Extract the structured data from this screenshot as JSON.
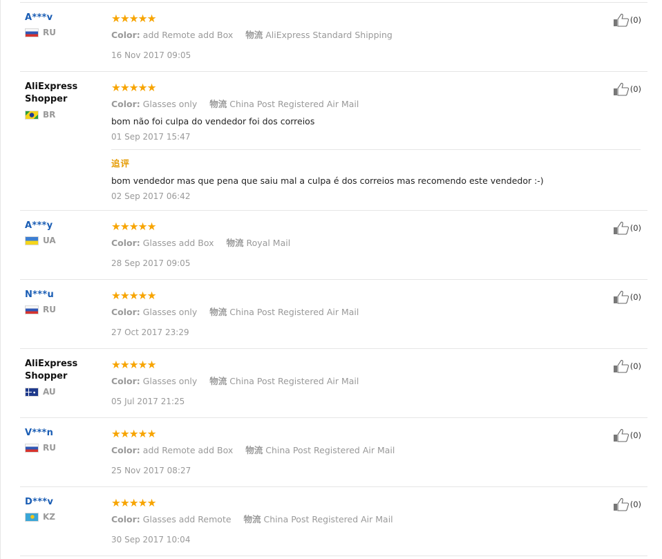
{
  "labels": {
    "color": "Color:",
    "shipping": "物流"
  },
  "reviews": [
    {
      "name": "A***v",
      "country": "RU",
      "flag": "ru",
      "rating": "★★★★★",
      "color": "add Remote add Box",
      "shipping": "AliExpress Standard Shipping",
      "date": "16 Nov 2017 09:05",
      "helpful": "(0)"
    },
    {
      "name": "AliExpress Shopper",
      "country": "BR",
      "flag": "br",
      "rating": "★★★★★",
      "color": "Glasses only",
      "shipping": "China Post Registered Air Mail",
      "text": "bom não foi culpa do vendedor foi dos correios",
      "date": "01 Sep 2017 15:47",
      "helpful": "(0)",
      "additional": {
        "title": "追评",
        "text": "bom vendedor mas que pena que saiu mal a culpa é dos correios mas recomendo este vendedor :-)",
        "date": "02 Sep 2017 06:42"
      }
    },
    {
      "name": "A***y",
      "country": "UA",
      "flag": "ua",
      "rating": "★★★★★",
      "color": "Glasses add Box",
      "shipping": "Royal Mail",
      "date": "28 Sep 2017 09:05",
      "helpful": "(0)"
    },
    {
      "name": "N***u",
      "country": "RU",
      "flag": "ru",
      "rating": "★★★★★",
      "color": "Glasses only",
      "shipping": "China Post Registered Air Mail",
      "date": "27 Oct 2017 23:29",
      "helpful": "(0)"
    },
    {
      "name": "AliExpress Shopper",
      "country": "AU",
      "flag": "au",
      "rating": "★★★★★",
      "color": "Glasses only",
      "shipping": "China Post Registered Air Mail",
      "date": "05 Jul 2017 21:25",
      "helpful": "(0)"
    },
    {
      "name": "V***n",
      "country": "RU",
      "flag": "ru",
      "rating": "★★★★★",
      "color": "add Remote add Box",
      "shipping": "China Post Registered Air Mail",
      "date": "25 Nov 2017 08:27",
      "helpful": "(0)"
    },
    {
      "name": "D***v",
      "country": "KZ",
      "flag": "kz",
      "rating": "★★★★★",
      "color": "Glasses add Remote",
      "shipping": "China Post Registered Air Mail",
      "date": "30 Sep 2017 10:04",
      "helpful": "(0)"
    }
  ]
}
